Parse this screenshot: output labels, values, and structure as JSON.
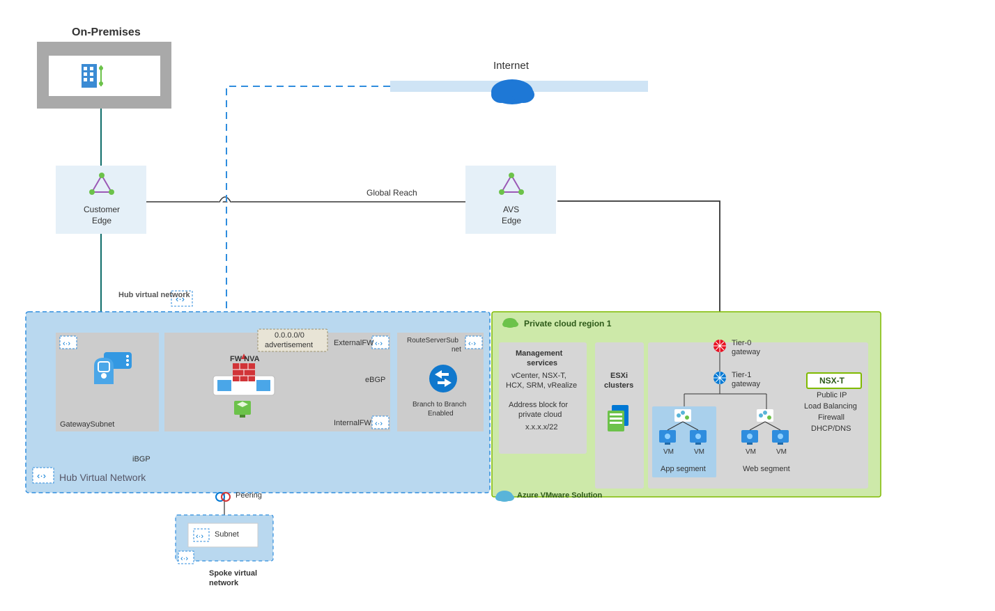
{
  "labels": {
    "onprem_title": "On-Premises",
    "internet": "Internet",
    "customer_edge_l1": "Customer",
    "customer_edge_l2": "Edge",
    "avs_edge_l1": "AVS",
    "avs_edge_l2": "Edge",
    "global_reach": "Global Reach",
    "hub_vnet_small": "Hub virtual network",
    "hub_vnet_big": "Hub Virtual Network",
    "default_route_l1": "0.0.0.0/0",
    "default_route_l2": "advertisement",
    "external_fw": "ExternalFW",
    "internal_fw": "InternalFW",
    "fw_nva": "FW NVA",
    "route_server_subnet_l1": "RouteServerSub",
    "route_server_subnet_l2": "net",
    "branch_l1": "Branch to Branch",
    "branch_l2": "Enabled",
    "gateway_subnet": "GatewaySubnet",
    "ebgp": "eBGP",
    "ibgp": "iBGP",
    "peering": "Peering",
    "subnet": "Subnet",
    "spoke_l1": "Spoke virtual",
    "spoke_l2": "network",
    "private_cloud_region": "Private cloud region 1",
    "mgmt_heading_l1": "Management",
    "mgmt_heading_l2": "services",
    "mgmt_body_l1": "vCenter, NSX-T,",
    "mgmt_body_l2": "HCX, SRM, vRealize",
    "mgmt_body_l3": "Address block for",
    "mgmt_body_l4": "private cloud",
    "mgmt_body_l5": "x.x.x.x/22",
    "esxi_l1": "ESXi",
    "esxi_l2": "clusters",
    "tier0_l1": "Tier-0",
    "tier0_l2": "gateway",
    "tier1_l1": "Tier-1",
    "tier1_l2": "gateway",
    "nsx_t": "NSX-T",
    "nsx_l1": "Public IP",
    "nsx_l2": "Load Balancing",
    "nsx_l3": "Firewall",
    "nsx_l4": "DHCP/DNS",
    "vm": "VM",
    "app_segment": "App segment",
    "web_segment": "Web segment",
    "avs": "Azure VMware Solution"
  },
  "colors": {
    "pale_blue": "#E5F0F8",
    "mid_blue": "#B9D8EF",
    "azure_blue": "#0078D4",
    "grey_box": "#B7B7B7",
    "grey_fill": "#CCCCCC",
    "green_bg": "#B4DE88",
    "green_border": "#7FBA00",
    "dark_teal": "#0F6D6A",
    "red": "#E81123",
    "nsx_green": "#7FBA00"
  }
}
